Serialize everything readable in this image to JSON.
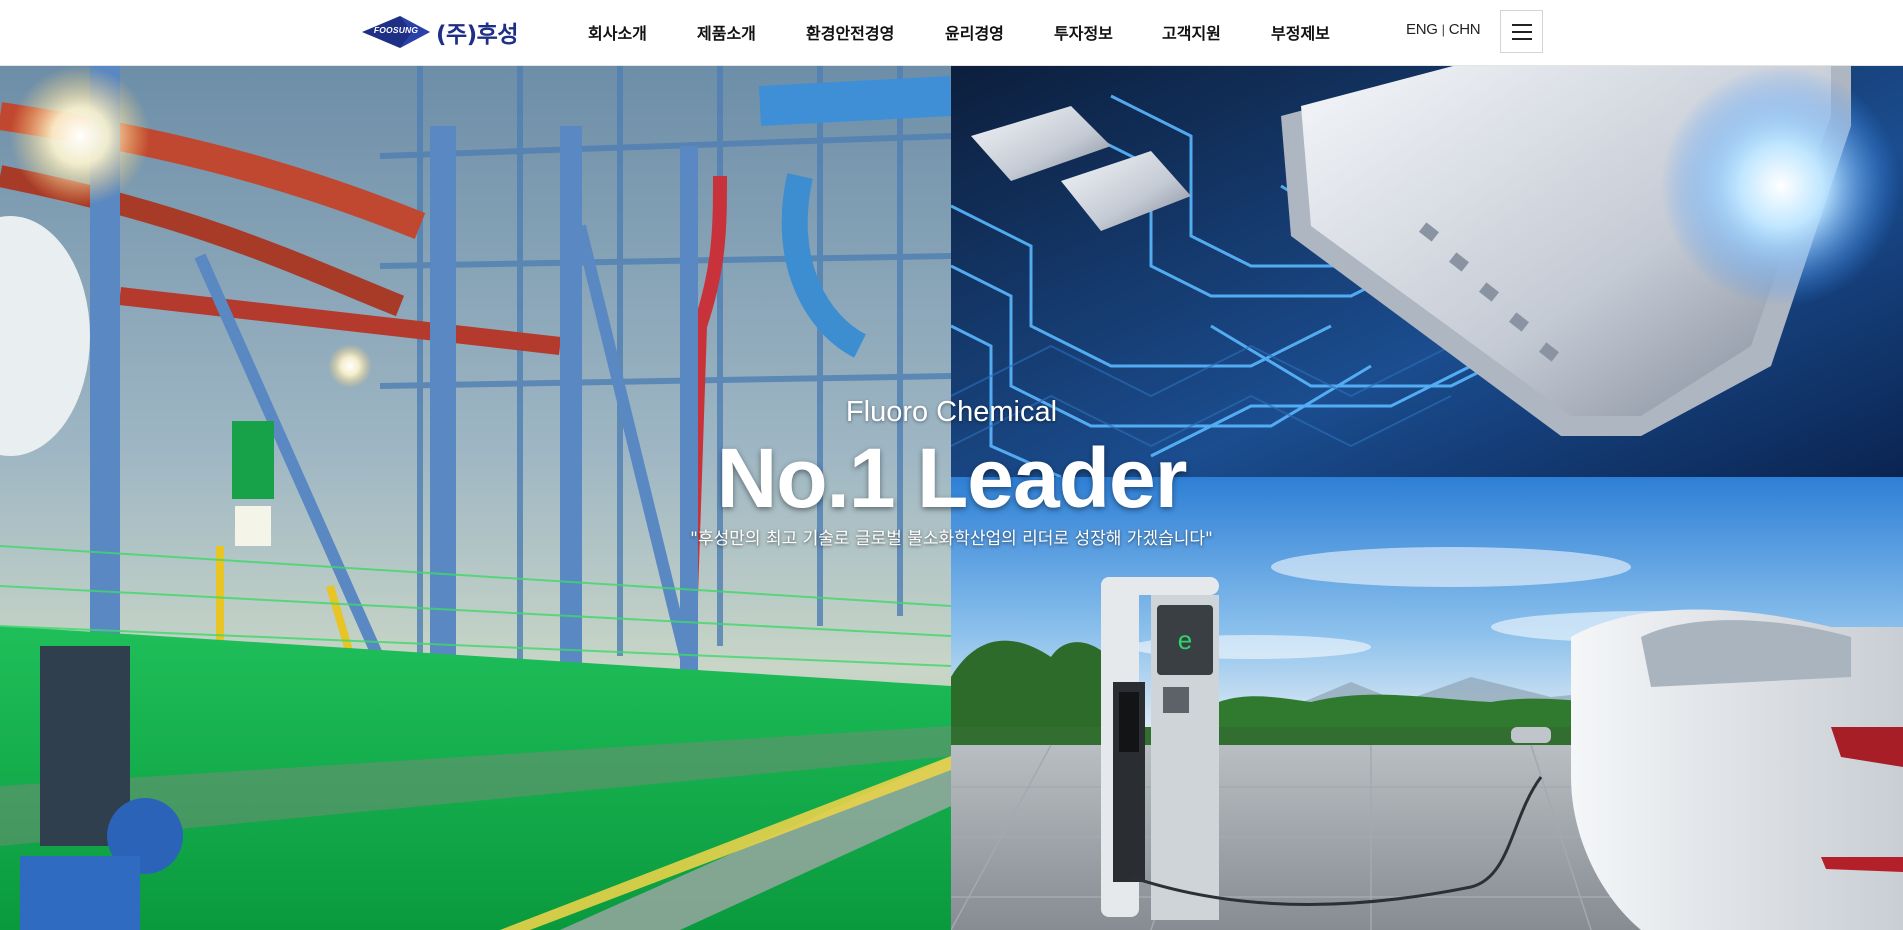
{
  "header": {
    "logo_mark_text": "FOOSUNG",
    "logo_name": "(주)후성",
    "nav": [
      {
        "label": "회사소개"
      },
      {
        "label": "제품소개"
      },
      {
        "label": "환경안전경영"
      },
      {
        "label": "윤리경영"
      },
      {
        "label": "투자정보"
      },
      {
        "label": "고객지원"
      },
      {
        "label": "부정제보"
      }
    ],
    "lang": {
      "eng": "ENG",
      "separator": "|",
      "chn": "CHN"
    },
    "menu_icon": "hamburger-icon"
  },
  "hero": {
    "subtitle": "Fluoro Chemical",
    "title": "No.1 Leader",
    "quote": "\"후성만의 최고 기술로 글로벌 불소화학산업의 리더로 성장해 가겠습니다\""
  },
  "colors": {
    "brand_navy": "#1e2f86",
    "header_bg": "#ffffff",
    "hero_text": "#ffffff"
  }
}
